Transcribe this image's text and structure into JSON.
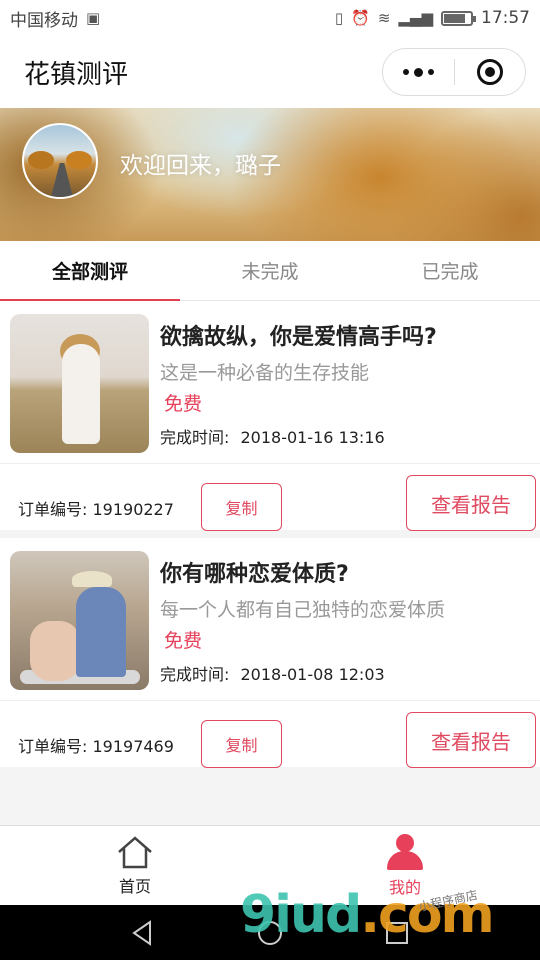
{
  "status_bar": {
    "carrier": "中国移动",
    "time": "17:57",
    "battery_level": 0.8
  },
  "nav": {
    "title": "花镇测评"
  },
  "banner": {
    "welcome": "欢迎回来，璐子"
  },
  "tabs": [
    {
      "label": "全部测评",
      "active": true
    },
    {
      "label": "未完成",
      "active": false
    },
    {
      "label": "已完成",
      "active": false
    }
  ],
  "orders": [
    {
      "title": "欲擒故纵，你是爱情高手吗?",
      "subtitle": "这是一种必备的生存技能",
      "price": "免费",
      "time_label": "完成时间:",
      "time_value": "2018-01-16 13:16",
      "order_no": "订单编号: 19190227",
      "copy_label": "复制",
      "report_label": "查看报告"
    },
    {
      "title": "你有哪种恋爱体质?",
      "subtitle": "每一个人都有自己独特的恋爱体质",
      "price": "免费",
      "time_label": "完成时间:",
      "time_value": "2018-01-08 12:03",
      "order_no": "订单编号: 19197469",
      "copy_label": "复制",
      "report_label": "查看报告"
    }
  ],
  "tabbar": [
    {
      "label": "首页",
      "icon": "home-icon",
      "active": false
    },
    {
      "label": "我的",
      "icon": "person-icon",
      "active": true
    }
  ],
  "watermark": {
    "main": "9iud",
    "suffix": ".com",
    "small": "小程序商店"
  },
  "colors": {
    "accent": "#e6405a",
    "tab_underline": "#e04050"
  }
}
